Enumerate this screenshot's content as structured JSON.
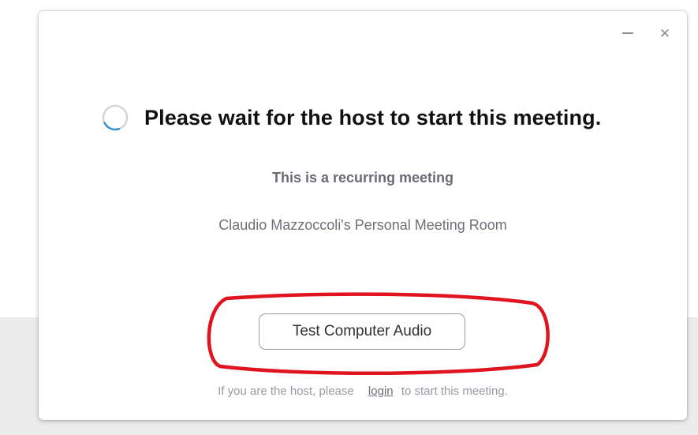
{
  "window": {
    "minimize_icon": "minimize-icon",
    "close_icon": "close-icon",
    "close_glyph": "✕"
  },
  "waiting": {
    "spinner_icon": "loading-spinner-icon",
    "title": "Please wait for the host to start this meeting."
  },
  "meeting": {
    "type_label": "This is a recurring meeting",
    "room_name": "Claudio Mazzoccoli's Personal Meeting Room"
  },
  "actions": {
    "test_audio_label": "Test Computer Audio"
  },
  "host_note": {
    "prefix": "If you are the host, please",
    "link_label": "login",
    "suffix": "to start this meeting."
  },
  "colors": {
    "annotation": "#e0141e",
    "spinner": "#3a8fd6"
  }
}
